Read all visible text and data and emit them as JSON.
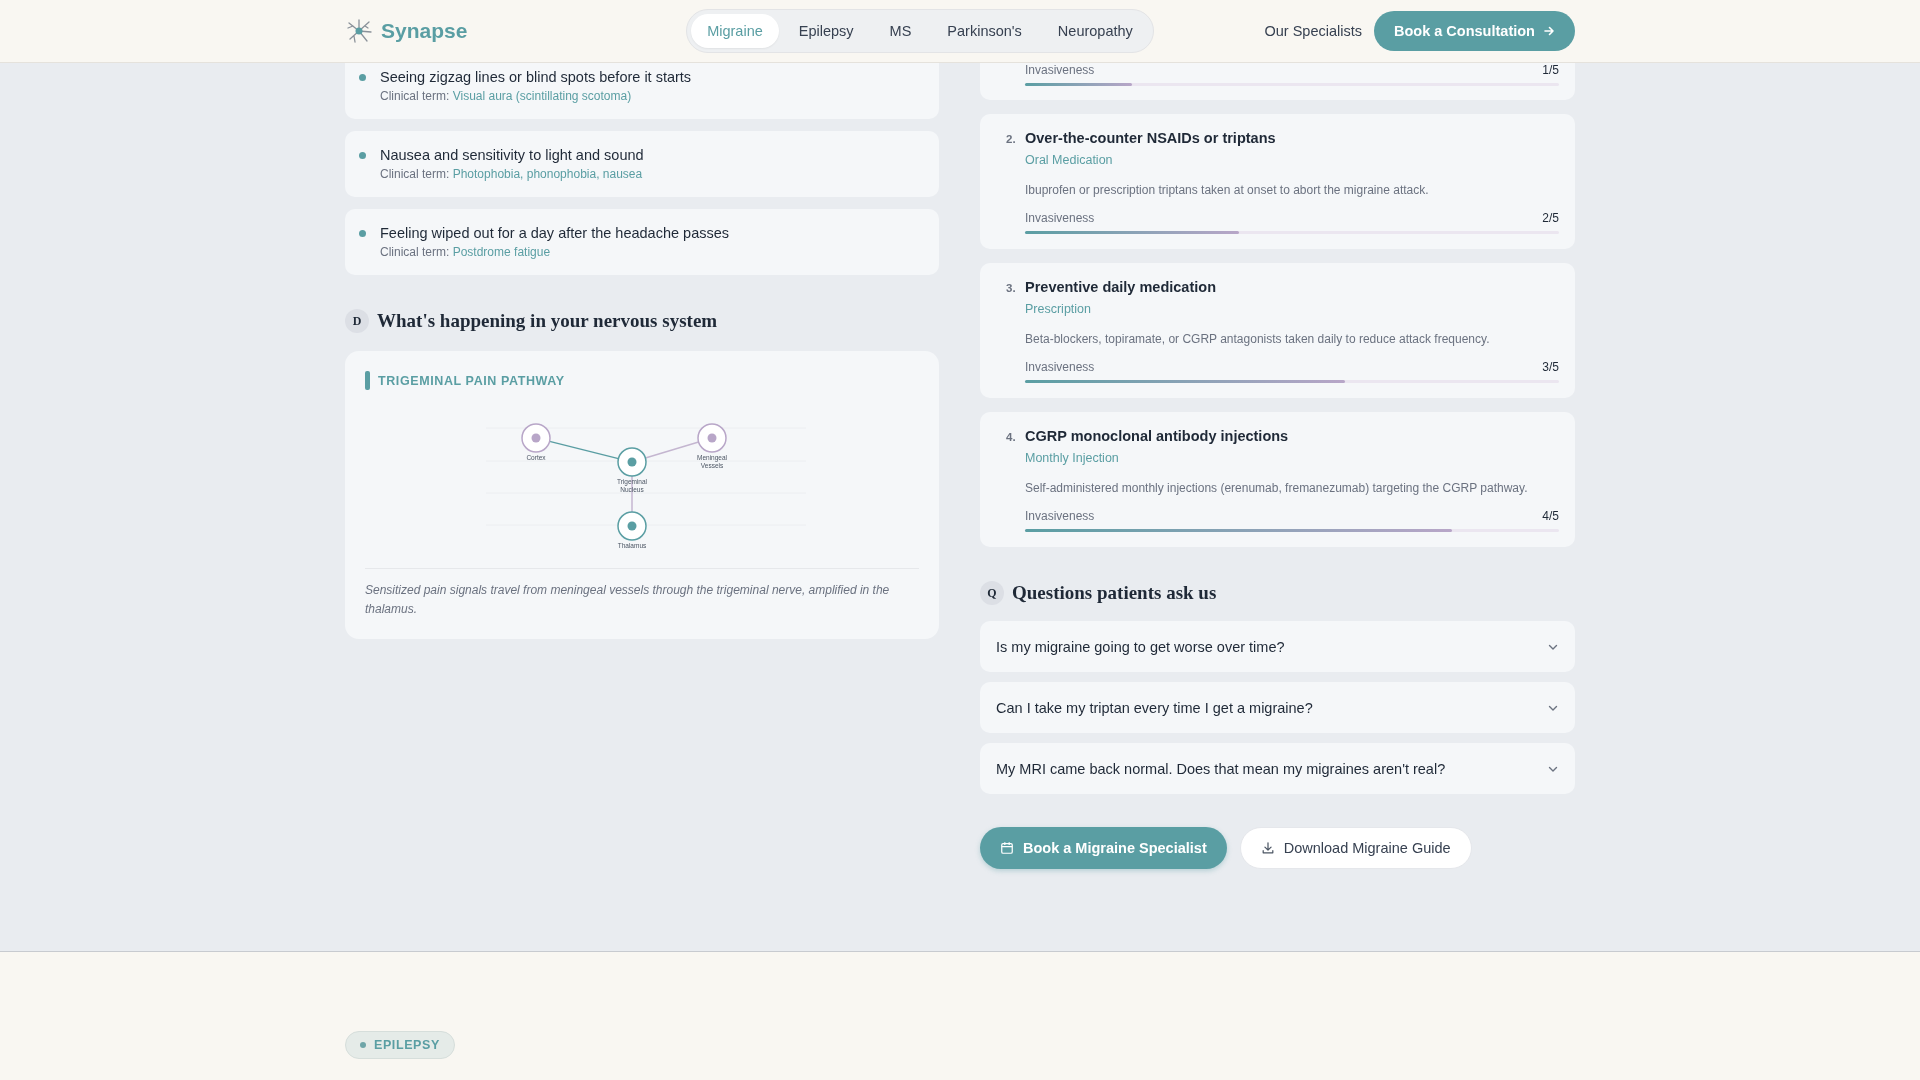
{
  "header": {
    "brand": "Synapse",
    "tabs": [
      {
        "label": "Migraine",
        "selected": true
      },
      {
        "label": "Epilepsy",
        "selected": false
      },
      {
        "label": "MS",
        "selected": false
      },
      {
        "label": "Parkinson's",
        "selected": false
      },
      {
        "label": "Neuropathy",
        "selected": false
      }
    ],
    "link": "Our Specialists",
    "cta": "Book a Consultation"
  },
  "symptoms": [
    {
      "text": "Seeing zigzag lines or blind spots before it starts",
      "term_label": "Clinical term:",
      "term": "Visual aura (scintillating scotoma)"
    },
    {
      "text": "Nausea and sensitivity to light and sound",
      "term_label": "Clinical term:",
      "term": "Photophobia, phonophobia, nausea"
    },
    {
      "text": "Feeling wiped out for a day after the headache passes",
      "term_label": "Clinical term:",
      "term": "Postdrome fatigue"
    }
  ],
  "mechanism": {
    "badge": "D",
    "heading": "What's happening in your nervous system",
    "diagram_title": "TRIGEMINAL PAIN PATHWAY",
    "nodes": [
      {
        "lines": [
          "Cortex"
        ],
        "color": "#b8a6c8"
      },
      {
        "lines": [
          "Trigeminal",
          "Nucleus"
        ],
        "color": "#5a9ea3"
      },
      {
        "lines": [
          "Meningeal",
          "Vessels"
        ],
        "color": "#b8a6c8"
      },
      {
        "lines": [
          "Thalamus"
        ],
        "color": "#5a9ea3"
      }
    ],
    "caption": "Sensitized pain signals travel from meningeal vessels through the trigeminal nerve, amplified in the thalamus."
  },
  "treatments": [
    {
      "meter_label": "Invasiveness",
      "reading": "1/5",
      "level": 0.2
    },
    {
      "number": "2.",
      "title": "Over-the-counter NSAIDs or triptans",
      "category": "Oral Medication",
      "description": "Ibuprofen or prescription triptans taken at onset to abort the migraine attack.",
      "meter_label": "Invasiveness",
      "reading": "2/5",
      "level": 0.4
    },
    {
      "number": "3.",
      "title": "Preventive daily medication",
      "category": "Prescription",
      "description": "Beta-blockers, topiramate, or CGRP antagonists taken daily to reduce attack frequency.",
      "meter_label": "Invasiveness",
      "reading": "3/5",
      "level": 0.6
    },
    {
      "number": "4.",
      "title": "CGRP monoclonal antibody injections",
      "category": "Monthly Injection",
      "description": "Self-administered monthly injections (erenumab, fremanezumab) targeting the CGRP pathway.",
      "meter_label": "Invasiveness",
      "reading": "4/5",
      "level": 0.8
    }
  ],
  "faq": {
    "badge": "Q",
    "heading": "Questions patients ask us",
    "items": [
      {
        "question": "Is my migraine going to get worse over time?",
        "expanded": false
      },
      {
        "question": "Can I take my triptan every time I get a migraine?",
        "expanded": false
      },
      {
        "question": "My MRI came back normal. Does that mean my migraines aren't real?",
        "expanded": false
      }
    ]
  },
  "actions": [
    {
      "kind": "primary",
      "label": "Book a Migraine Specialist"
    },
    {
      "kind": "secondary",
      "label": "Download Migraine Guide"
    }
  ],
  "next_section": {
    "tag": "EPILEPSY"
  }
}
